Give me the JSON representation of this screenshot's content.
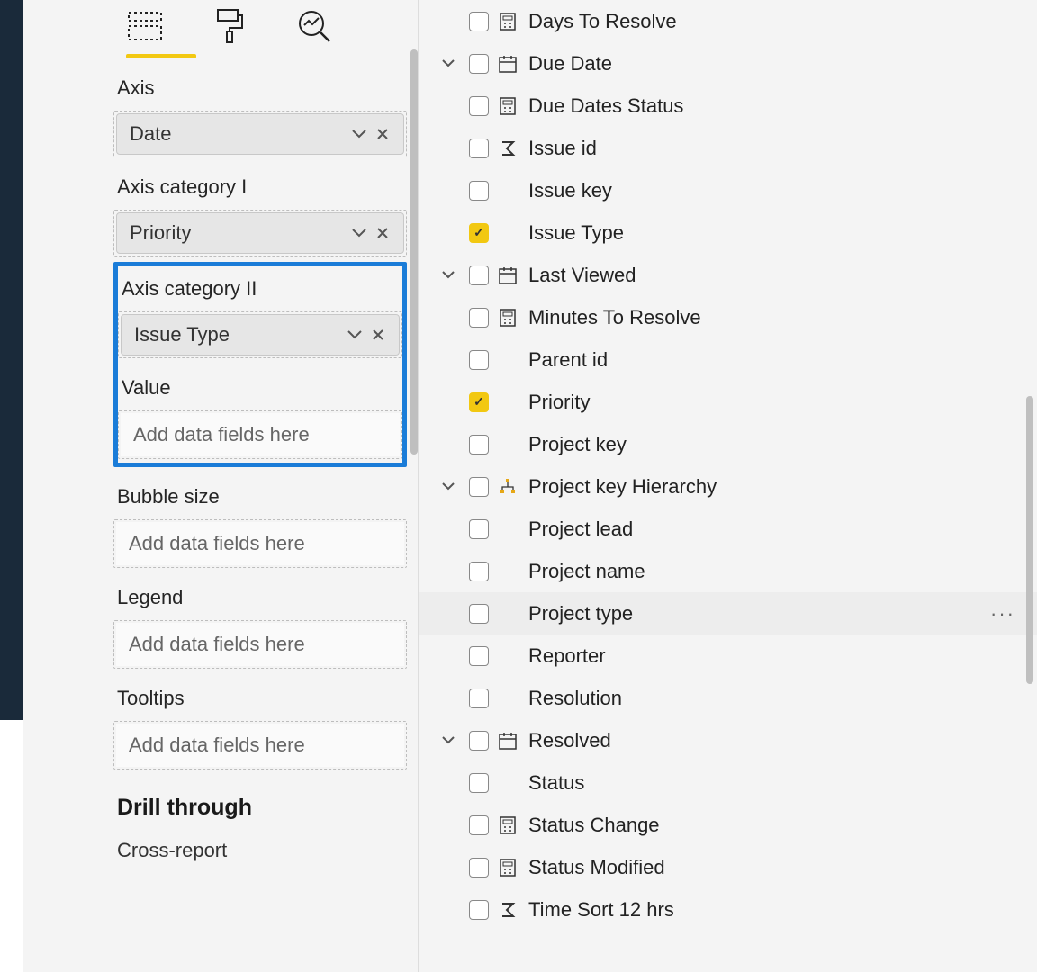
{
  "viz": {
    "sections": {
      "axis": {
        "label": "Axis",
        "field": "Date"
      },
      "axisCat1": {
        "label": "Axis category I",
        "field": "Priority"
      },
      "axisCat2": {
        "label": "Axis category II",
        "field": "Issue Type"
      },
      "value": {
        "label": "Value",
        "placeholder": "Add data fields here"
      },
      "bubble": {
        "label": "Bubble size",
        "placeholder": "Add data fields here"
      },
      "legend": {
        "label": "Legend",
        "placeholder": "Add data fields here"
      },
      "tooltips": {
        "label": "Tooltips",
        "placeholder": "Add data fields here"
      }
    },
    "drillthrough": "Drill through",
    "crossReport": "Cross-report"
  },
  "fields": [
    {
      "label": "Days To Resolve",
      "icon": "calc",
      "checked": false,
      "expander": false
    },
    {
      "label": "Due Date",
      "icon": "cal",
      "checked": false,
      "expander": true
    },
    {
      "label": "Due Dates Status",
      "icon": "calc",
      "checked": false,
      "expander": false
    },
    {
      "label": "Issue id",
      "icon": "sigma",
      "checked": false,
      "expander": false
    },
    {
      "label": "Issue key",
      "icon": "none",
      "checked": false,
      "expander": false
    },
    {
      "label": "Issue Type",
      "icon": "none",
      "checked": true,
      "expander": false
    },
    {
      "label": "Last Viewed",
      "icon": "cal",
      "checked": false,
      "expander": true
    },
    {
      "label": "Minutes To Resolve",
      "icon": "calc",
      "checked": false,
      "expander": false
    },
    {
      "label": "Parent id",
      "icon": "none",
      "checked": false,
      "expander": false
    },
    {
      "label": "Priority",
      "icon": "none",
      "checked": true,
      "expander": false
    },
    {
      "label": "Project key",
      "icon": "none",
      "checked": false,
      "expander": false
    },
    {
      "label": "Project key Hierarchy",
      "icon": "hier",
      "checked": false,
      "expander": true
    },
    {
      "label": "Project lead",
      "icon": "none",
      "checked": false,
      "expander": false
    },
    {
      "label": "Project name",
      "icon": "none",
      "checked": false,
      "expander": false
    },
    {
      "label": "Project type",
      "icon": "none",
      "checked": false,
      "expander": false,
      "hover": true
    },
    {
      "label": "Reporter",
      "icon": "none",
      "checked": false,
      "expander": false
    },
    {
      "label": "Resolution",
      "icon": "none",
      "checked": false,
      "expander": false
    },
    {
      "label": "Resolved",
      "icon": "cal",
      "checked": false,
      "expander": true
    },
    {
      "label": "Status",
      "icon": "none",
      "checked": false,
      "expander": false
    },
    {
      "label": "Status Change",
      "icon": "calc",
      "checked": false,
      "expander": false
    },
    {
      "label": "Status Modified",
      "icon": "calc",
      "checked": false,
      "expander": false
    },
    {
      "label": "Time Sort 12 hrs",
      "icon": "sigma",
      "checked": false,
      "expander": false
    }
  ]
}
